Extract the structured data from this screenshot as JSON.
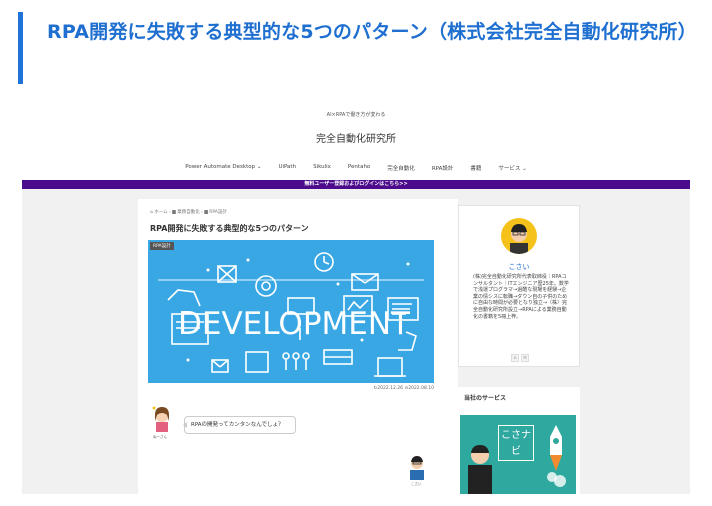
{
  "card": {
    "title": "RPA開発に失敗する典型的な5つのパターン（株式会社完全自動化研究所）"
  },
  "site": {
    "catchphrase": "AI×RPAで働き方が変わる",
    "name": "完全自動化研究所",
    "nav": [
      "Power Automate Desktop ⌄",
      "UiPath",
      "Sikulix",
      "Pentaho",
      "完全自動化",
      "RPA設計",
      "書籍",
      "サービス ⌄"
    ],
    "notice": "無料ユーザー登録およびログインはこちら>>"
  },
  "article": {
    "breadcrumb": "⌂ ホーム  ›  ▆ 業務自動化  ›  ▆ RPA設計",
    "title": "RPA開発に失敗する典型的な5つのパターン",
    "category": "RPA設計",
    "eyecatch_text": "DEVELOPMENT",
    "dates": "↻2022.12.26   ⊙2022.08.10",
    "speaker1": "ぬーさん",
    "balloon1": "RPAの開発ってカンタンなんでしょ？",
    "speaker2": "こさい"
  },
  "sidebar": {
    "profile_name": "こさい",
    "profile_desc": "(株)完全自動化研究所代表取締役｜RPAコンサルタント｜ITエンジニア歴25年。数学で浅運プログラマ→過酷な現場を経験→企業の情シスに転職→ダウン自の子供のために自由な時間が必要となり独立→（株）完全自動化研究所設立→RPAによる業務自動化の書籍を5冊上梓。",
    "services_title": "当社のサービス",
    "banner_text": "こさナビ"
  },
  "colors": {
    "accent": "#1e6fd0",
    "notice_bar": "#4b0b8c",
    "eyecatch_bg": "#3aa7e5"
  }
}
